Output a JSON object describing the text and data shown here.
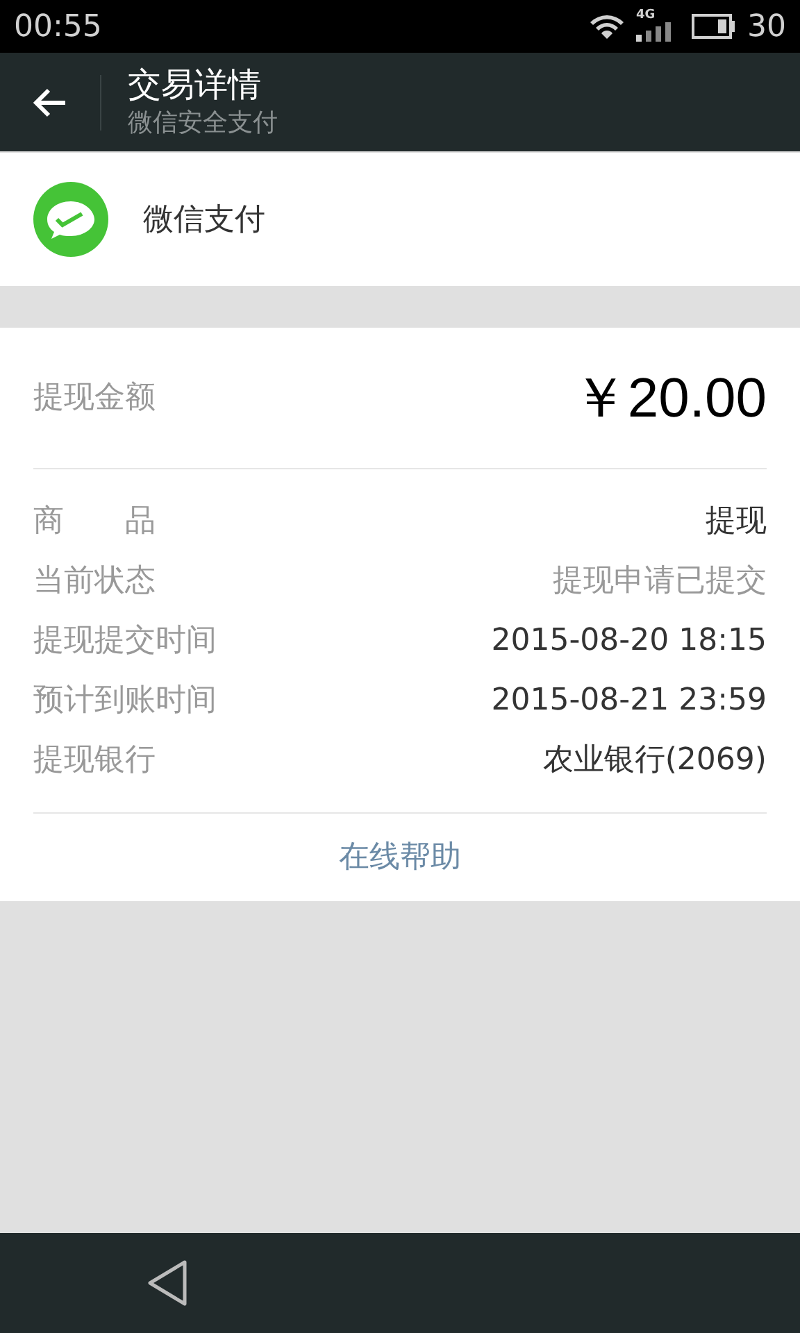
{
  "status_bar": {
    "time": "00:55",
    "network": "4G",
    "battery": "30"
  },
  "header": {
    "title": "交易详情",
    "subtitle": "微信安全支付"
  },
  "merchant": {
    "name": "微信支付"
  },
  "amount": {
    "label": "提现金额",
    "value": "￥20.00"
  },
  "details": [
    {
      "label": "商　　品",
      "value": "提现",
      "muted": false
    },
    {
      "label": "当前状态",
      "value": "提现申请已提交",
      "muted": true
    },
    {
      "label": "提现提交时间",
      "value": "2015-08-20 18:15",
      "muted": false
    },
    {
      "label": "预计到账时间",
      "value": "2015-08-21 23:59",
      "muted": false
    },
    {
      "label": "提现银行",
      "value": "农业银行(2069)",
      "muted": false
    }
  ],
  "help_link": "在线帮助"
}
